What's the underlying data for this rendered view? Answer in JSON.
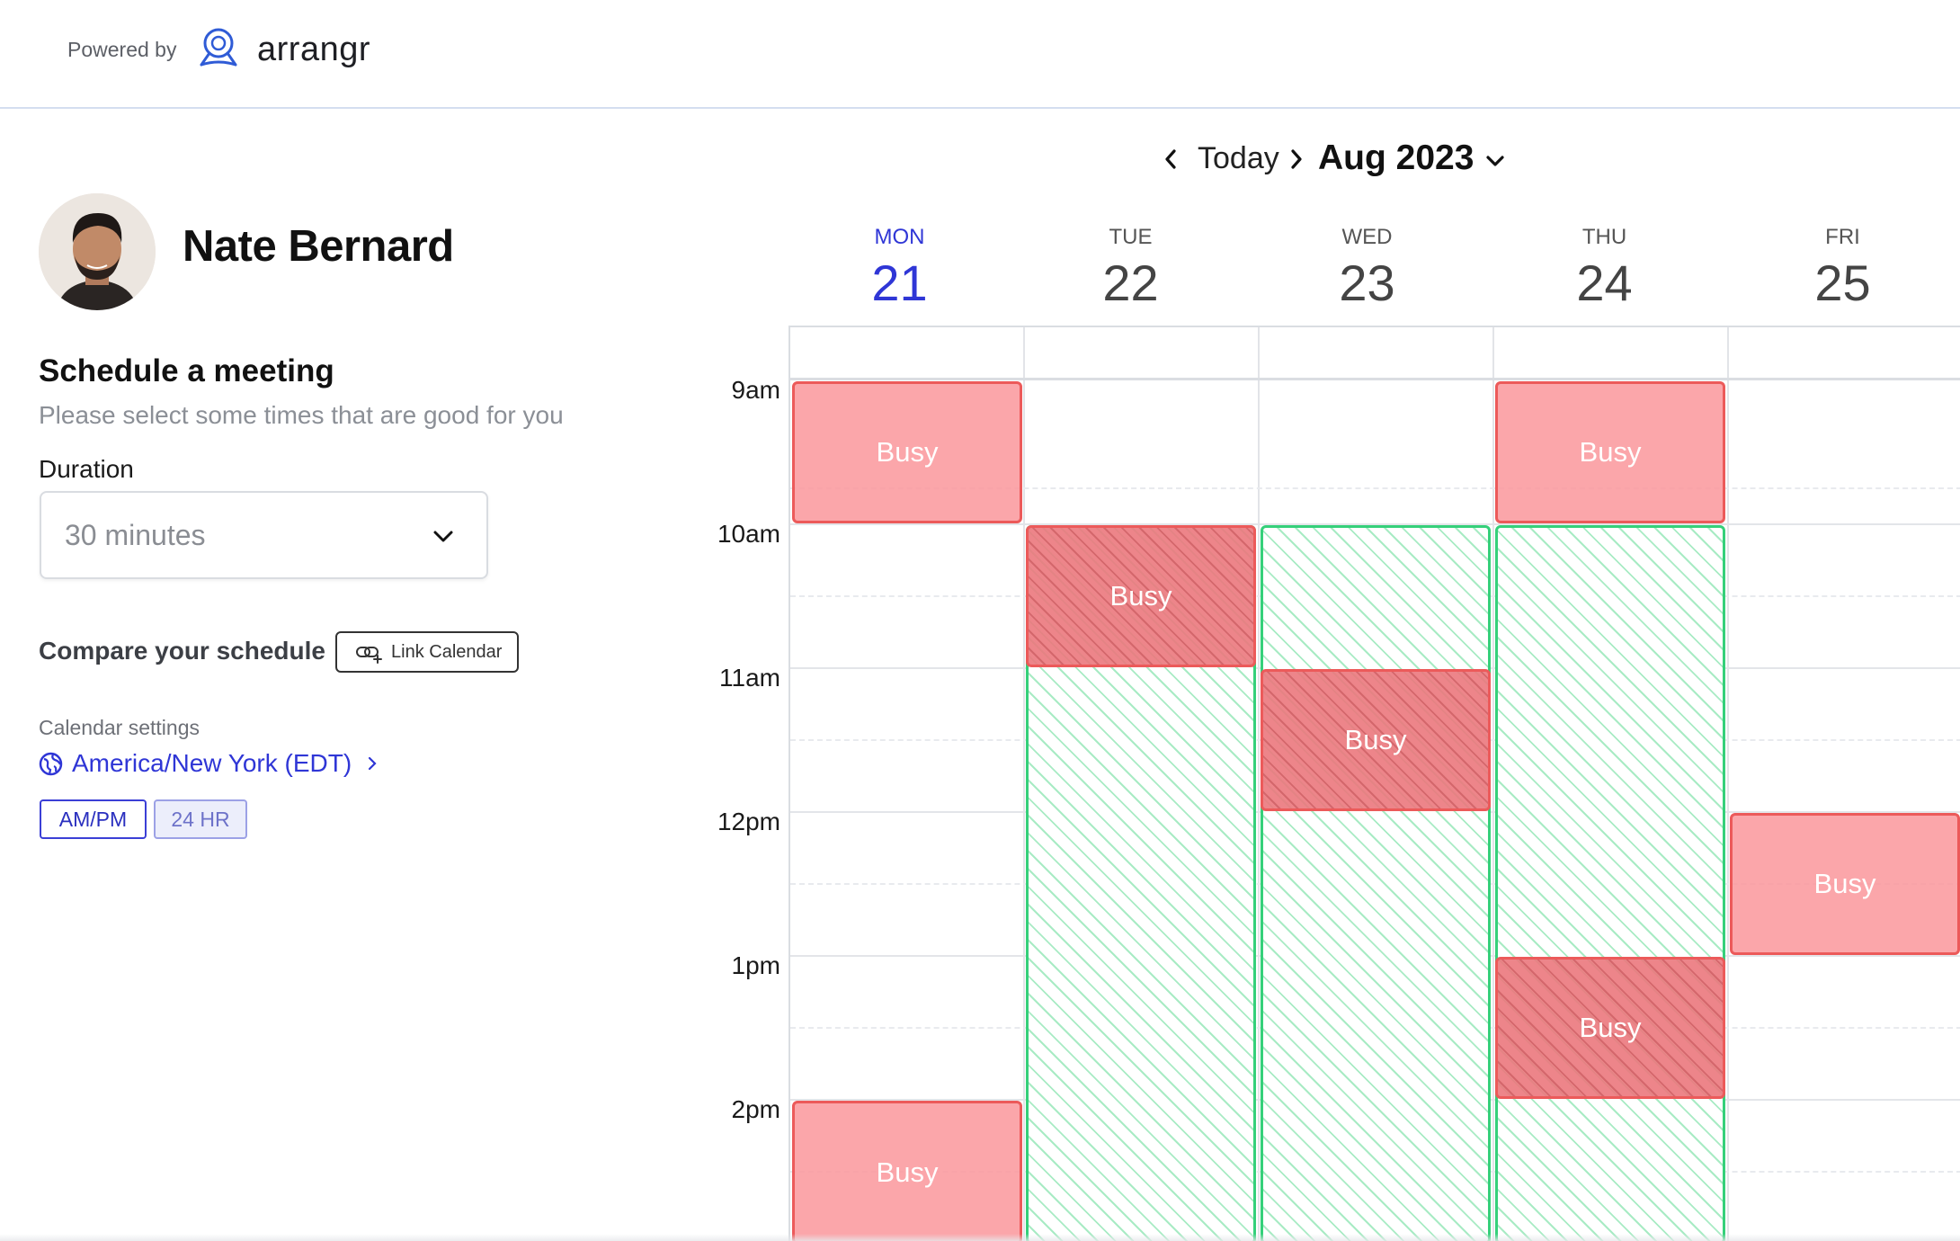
{
  "branding": {
    "powered_by": "Powered by",
    "logo_text": "arrangr"
  },
  "host": {
    "name": "Nate Bernard"
  },
  "schedule": {
    "title": "Schedule a meeting",
    "subtitle": "Please select some times that are good for you",
    "duration_label": "Duration",
    "duration_value": "30 minutes",
    "compare_label": "Compare your schedule",
    "link_calendar_label": "Link Calendar"
  },
  "settings": {
    "label": "Calendar settings",
    "timezone": "America/New York (EDT)",
    "format_ampm": "AM/PM",
    "format_24": "24 HR",
    "selected_format": "AM/PM"
  },
  "calendar": {
    "today_label": "Today",
    "month_label": "Aug 2023",
    "days": [
      {
        "name": "MON",
        "num": "21",
        "today": true
      },
      {
        "name": "TUE",
        "num": "22",
        "today": false
      },
      {
        "name": "WED",
        "num": "23",
        "today": false
      },
      {
        "name": "THU",
        "num": "24",
        "today": false
      },
      {
        "name": "FRI",
        "num": "25",
        "today": false
      }
    ],
    "times": [
      "9am",
      "10am",
      "11am",
      "12pm",
      "1pm",
      "2pm"
    ],
    "busy_label": "Busy",
    "colors": {
      "busy_fill": "#f9a5a8",
      "busy_border": "#ec5a5a",
      "available_border": "#35d07a",
      "accent": "#2f36d6"
    }
  }
}
